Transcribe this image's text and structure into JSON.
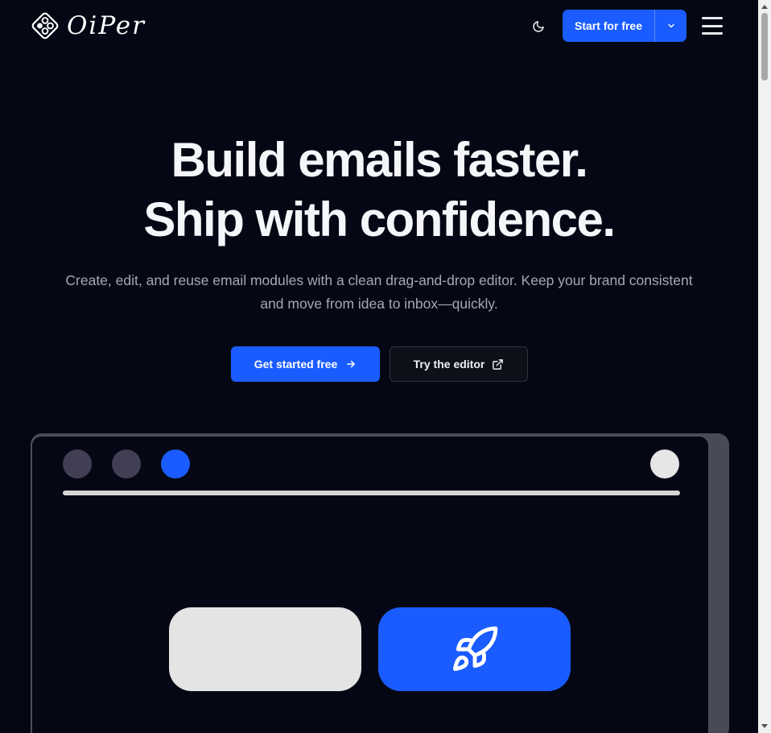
{
  "header": {
    "logo_text": "OiPer",
    "theme_toggle_icon": "moon-icon",
    "start_button_label": "Start for free",
    "start_button_dropdown_icon": "chevron-down-icon",
    "menu_icon": "hamburger-menu-icon"
  },
  "hero": {
    "title_line1": "Build emails faster.",
    "title_line2": "Ship with confidence.",
    "subtitle_line1": "Create, edit, and reuse email modules with a clean drag-and-drop editor. Keep your brand consistent",
    "subtitle_line2": "and move from idea to inbox—quickly.",
    "cta_primary_label": "Get started free",
    "cta_primary_icon": "arrow-right-icon",
    "cta_secondary_label": "Try the editor",
    "cta_secondary_icon": "external-link-icon"
  },
  "mock_editor": {
    "block_icon": "rocket-icon"
  },
  "colors": {
    "background": "#050814",
    "accent": "#1a5cff",
    "muted_text": "#a3a9b8"
  }
}
